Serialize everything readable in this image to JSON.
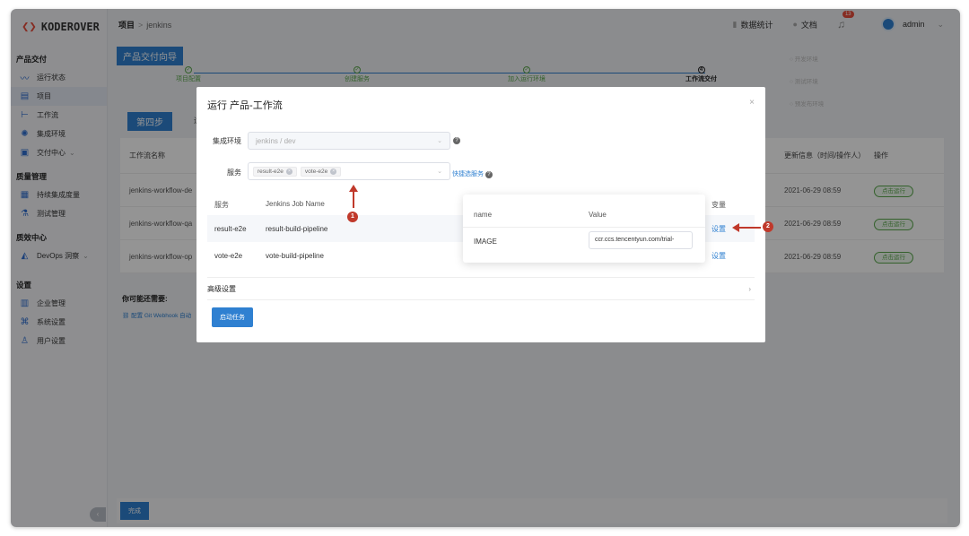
{
  "brand": {
    "logo_text": "KODEROVER",
    "accent": "#e74c3c"
  },
  "sidebar": {
    "groups": [
      {
        "label": "产品交付",
        "items": [
          "运行状态",
          "项目",
          "工作流",
          "集成环境",
          "交付中心"
        ]
      },
      {
        "label": "质量管理",
        "items": [
          "持续集成度量",
          "测试管理"
        ]
      },
      {
        "label": "质效中心",
        "items": [
          "DevOps 洞察"
        ]
      },
      {
        "label": "设置",
        "items": [
          "企业管理",
          "系统设置",
          "用户设置"
        ]
      }
    ]
  },
  "topbar": {
    "crumb_root": "项目",
    "crumb_sep": ">",
    "crumb_current": "jenkins",
    "stats_label": "数据统计",
    "docs_label": "文档",
    "notify_count": "13",
    "username": "admin"
  },
  "main": {
    "wizard_label": "产品交付向导",
    "steps": [
      {
        "label": "项目配置",
        "mark": "✓"
      },
      {
        "label": "创建服务",
        "mark": "✓"
      },
      {
        "label": "加入运行环境",
        "mark": "✓"
      },
      {
        "label": "工作流交付",
        "mark": "4"
      }
    ],
    "env_list": [
      "开发环境",
      "测试环境",
      "预发布环境"
    ],
    "step4_label": "第四步",
    "step4_sub": "运行",
    "table_headers": {
      "name": "工作流名称",
      "update": "更新信息（时间/操作人）",
      "action": "操作"
    },
    "rows": [
      {
        "name": "jenkins-workflow-de",
        "time": "2021-06-29 08:59",
        "action": "点击运行"
      },
      {
        "name": "jenkins-workflow-qa",
        "time": "2021-06-29 08:59",
        "action": "点击运行"
      },
      {
        "name": "jenkins-workflow-op",
        "time": "2021-06-29 08:59",
        "action": "点击运行"
      }
    ],
    "need_title": "你可能还需要:",
    "need_link": "配置 Git Webhook 自动",
    "done_label": "完成"
  },
  "modal": {
    "title": "运行 产品-工作流",
    "close": "×",
    "env_label": "集成环境",
    "env_value": "jenkins / dev",
    "service_label": "服务",
    "service_tags": [
      "result-e2e",
      "vote-e2e"
    ],
    "quick_select": "快捷选服务",
    "table_headers": {
      "service": "服务",
      "job": "Jenkins Job Name",
      "vars": "变量"
    },
    "rows": [
      {
        "service": "result-e2e",
        "job": "result-build-pipeline",
        "action": "设置"
      },
      {
        "service": "vote-e2e",
        "job": "vote-build-pipeline",
        "action": "设置"
      }
    ],
    "advanced": "高级设置",
    "start": "启动任务"
  },
  "popover": {
    "head_name": "name",
    "head_value": "Value",
    "var_name": "IMAGE",
    "var_value": "ccr.ccs.tencentyun.com/trial-"
  },
  "annotations": [
    "1",
    "2"
  ]
}
